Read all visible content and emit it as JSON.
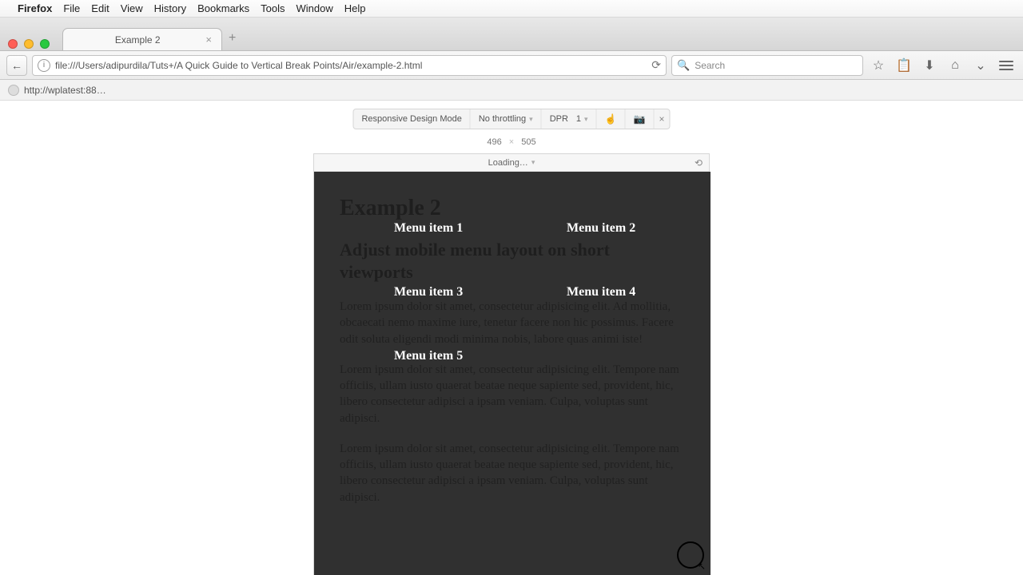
{
  "menubar": {
    "app": "Firefox",
    "items": [
      "File",
      "Edit",
      "View",
      "History",
      "Bookmarks",
      "Tools",
      "Window",
      "Help"
    ]
  },
  "tab": {
    "title": "Example 2"
  },
  "urlbar": {
    "url": "file:///Users/adipurdila/Tuts+/A Quick Guide to Vertical Break Points/Air/example-2.html",
    "search_placeholder": "Search"
  },
  "bookmarks": {
    "item0": "http://wplatest:88…"
  },
  "rdm": {
    "label": "Responsive Design Mode",
    "throttling": "No throttling",
    "dpr_label": "DPR",
    "dpr_value": "1",
    "width": "496",
    "height": "505",
    "device": "Loading…"
  },
  "page": {
    "h1": "Example 2",
    "h2": "Adjust mobile menu layout on short viewports",
    "p1": "Lorem ipsum dolor sit amet, consectetur adipisicing elit. Ad mollitia, obcaecati nemo maxime iure, tenetur facere non hic possimus. Facere odit soluta eligendi modi minima nobis, labore quas animi iste!",
    "p2": "Lorem ipsum dolor sit amet, consectetur adipisicing elit. Tempore nam officiis, ullam iusto quaerat beatae neque sapiente sed, provident, hic, libero consectetur adipisci a ipsam veniam. Culpa, voluptas sunt adipisci.",
    "p3": "Lorem ipsum dolor sit amet, consectetur adipisicing elit. Tempore nam officiis, ullam iusto quaerat beatae neque sapiente sed, provident, hic, libero consectetur adipisci a ipsam veniam. Culpa, voluptas sunt adipisci."
  },
  "menu": {
    "items": [
      "Menu item 1",
      "Menu item 2",
      "Menu item 3",
      "Menu item 4",
      "Menu item 5"
    ]
  }
}
